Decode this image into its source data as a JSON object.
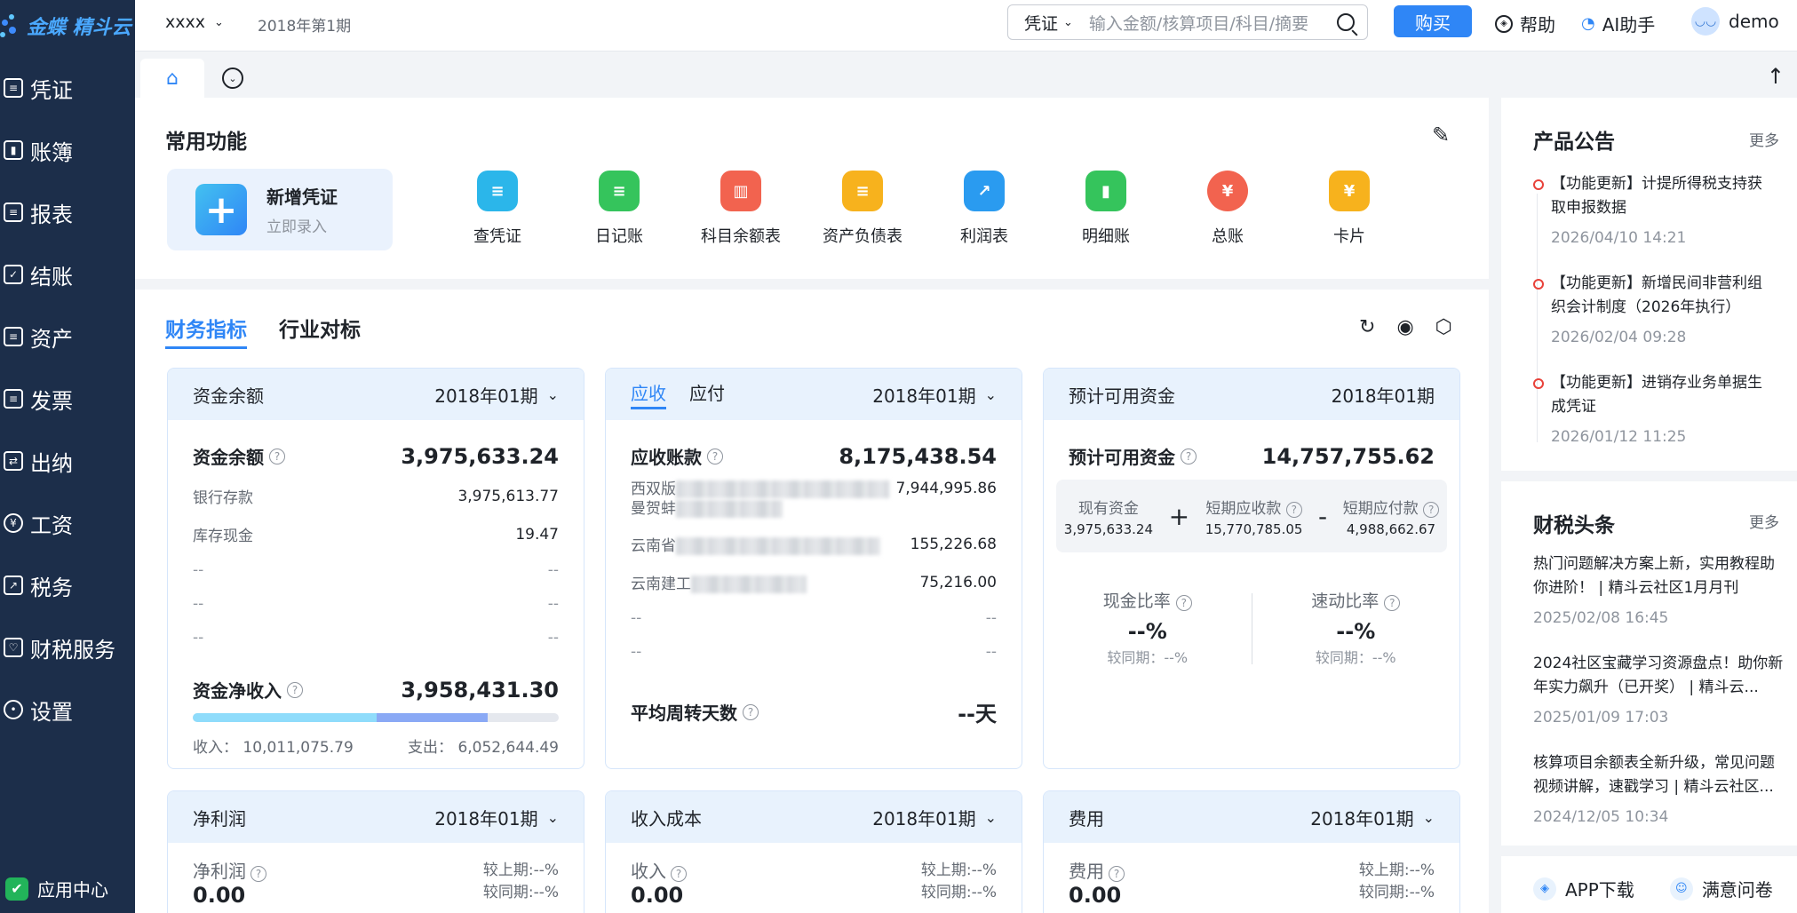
{
  "app": {
    "logo_text": "金蝶 精斗云"
  },
  "sidebar": {
    "items": [
      {
        "label": "凭证"
      },
      {
        "label": "账簿"
      },
      {
        "label": "报表"
      },
      {
        "label": "结账"
      },
      {
        "label": "资产"
      },
      {
        "label": "发票"
      },
      {
        "label": "出纳"
      },
      {
        "label": "工资"
      },
      {
        "label": "税务"
      },
      {
        "label": "财税服务"
      },
      {
        "label": "设置"
      }
    ],
    "app_center": "应用中心"
  },
  "topbar": {
    "org": "xxxx",
    "period": "2018年第1期",
    "search_type": "凭证",
    "search_placeholder": "输入金额/核算项目/科目/摘要",
    "buy": "购买",
    "help": "帮助",
    "ai": "AI助手",
    "user": "demo"
  },
  "common": {
    "title": "常用功能",
    "new_voucher": {
      "title": "新增凭证",
      "sub": "立即录入"
    },
    "functions": [
      {
        "label": "查凭证",
        "color": "#2bb6ea"
      },
      {
        "label": "日记账",
        "color": "#35c45c"
      },
      {
        "label": "科目余额表",
        "color": "#f2634f"
      },
      {
        "label": "资产负债表",
        "color": "#f7b21d"
      },
      {
        "label": "利润表",
        "color": "#2a9bf0"
      },
      {
        "label": "明细账",
        "color": "#35c45c"
      },
      {
        "label": "总账",
        "color": "#f2634f"
      },
      {
        "label": "卡片",
        "color": "#f7b21d"
      }
    ]
  },
  "finance": {
    "tab_active": "财务指标",
    "tab_other": "行业对标",
    "cash": {
      "head": "资金余额",
      "period": "2018年01期",
      "label": "资金余额",
      "value": "3,975,633.24",
      "rows": [
        {
          "k": "银行存款",
          "v": "3,975,613.77"
        },
        {
          "k": "库存现金",
          "v": "19.47"
        },
        {
          "k": "--",
          "v": "--"
        },
        {
          "k": "--",
          "v": "--"
        },
        {
          "k": "--",
          "v": "--"
        }
      ],
      "net_label": "资金净收入",
      "net_value": "3,958,431.30",
      "income_fraction": 0.503,
      "expense_fraction": 0.302,
      "income_label": "收入：",
      "income": "10,011,075.79",
      "expense_label": "支出：",
      "expense": "6,052,644.49"
    },
    "ar": {
      "tab_active": "应收",
      "tab_other": "应付",
      "period": "2018年01期",
      "label": "应收账款",
      "value": "8,175,438.54",
      "rows": [
        {
          "k": "西双版",
          "k2": "曼贺蚌",
          "v": "7,944,995.86"
        },
        {
          "k": "云南省",
          "v": "155,226.68"
        },
        {
          "k": "云南建工",
          "v": "75,216.00"
        },
        {
          "k": "--",
          "v": "--"
        },
        {
          "k": "--",
          "v": "--"
        }
      ],
      "turnover_label": "平均周转天数",
      "turnover_value": "--天"
    },
    "avail": {
      "head": "预计可用资金",
      "period": "2018年01期",
      "label": "预计可用资金",
      "value": "14,757,755.62",
      "cur_label": "现有资金",
      "cur_value": "3,975,633.24",
      "plus": "+",
      "ar_label": "短期应收款",
      "ar_value": "15,770,785.05",
      "minus": "-",
      "ap_label": "短期应付款",
      "ap_value": "4,988,662.67",
      "ratio1_label": "现金比率",
      "ratio1_value": "--%",
      "ratio1_sub": "较同期：--%",
      "ratio2_label": "速动比率",
      "ratio2_value": "--%",
      "ratio2_sub": "较同期：--%"
    },
    "profit": {
      "head": "净利润",
      "period": "2018年01期",
      "label": "净利润",
      "value": "0.00",
      "cmp1": "较上期:--%",
      "cmp2": "较同期:--%"
    },
    "revenue": {
      "head": "收入成本",
      "period": "2018年01期",
      "label": "收入",
      "value": "0.00",
      "cmp1": "较上期:--%",
      "cmp2": "较同期:--%"
    },
    "expense": {
      "head": "费用",
      "period": "2018年01期",
      "label": "费用",
      "value": "0.00",
      "cmp1": "较上期:--%",
      "cmp2": "较同期:--%"
    }
  },
  "announcements": {
    "title": "产品公告",
    "more": "更多",
    "items": [
      {
        "text": "【功能更新】计提所得税支持获取申报数据",
        "date": "2026/04/10 14:21"
      },
      {
        "text": "【功能更新】新增民间非营利组织会计制度（2026年执行）",
        "date": "2026/02/04 09:28"
      },
      {
        "text": "【功能更新】进销存业务单据生成凭证",
        "date": "2026/01/12 11:25"
      }
    ]
  },
  "news": {
    "title": "财税头条",
    "more": "更多",
    "items": [
      {
        "text": "热门问题解决方案上新，实用教程助你进阶！ | 精斗云社区1月月刊",
        "date": "2025/02/08 16:45"
      },
      {
        "text": "2024社区宝藏学习资源盘点！助你新年实力飙升（已开奖） | 精斗云...",
        "date": "2025/01/09 17:03"
      },
      {
        "text": "核算项目余额表全新升级，常见问题视频讲解，速戳学习 | 精斗云社区...",
        "date": "2024/12/05 10:34"
      }
    ]
  },
  "bottom": {
    "app_download": "APP下载",
    "survey": "满意问卷"
  }
}
